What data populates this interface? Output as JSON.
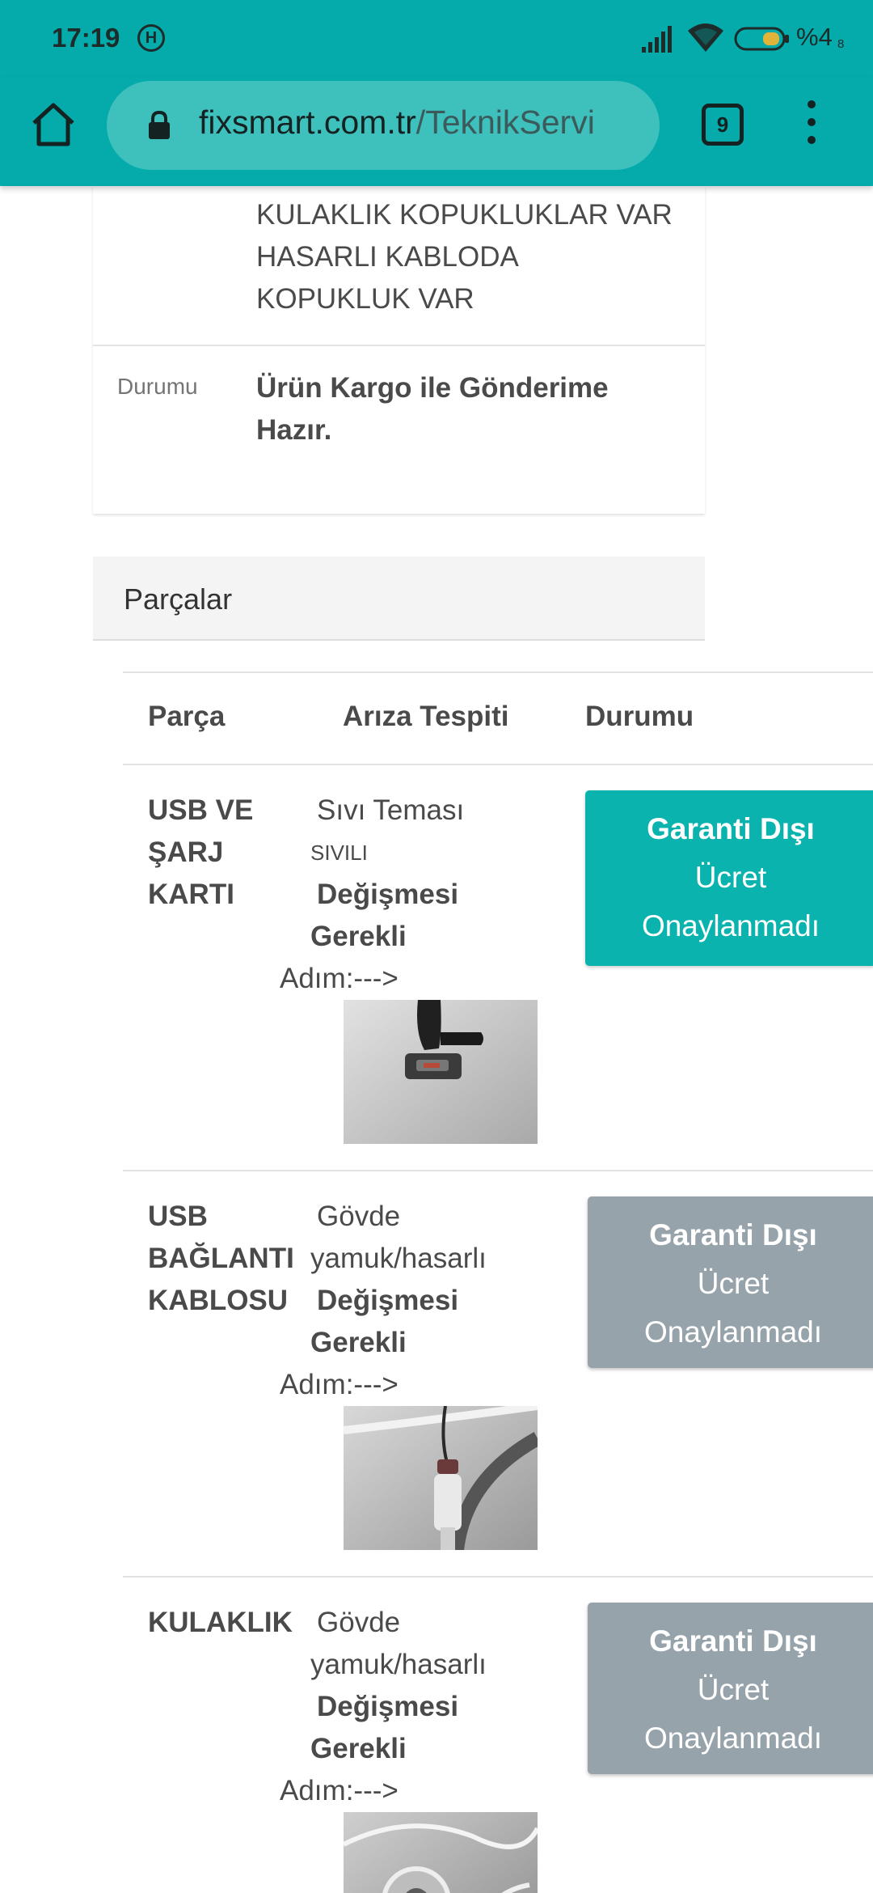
{
  "status_bar": {
    "time": "17:19",
    "h_badge": "H",
    "battery_percent": "%4",
    "battery_sub": "8"
  },
  "browser": {
    "url_domain": "fixsmart.com.tr",
    "url_path": "/TeknikServi",
    "tab_count": "9",
    "icons": [
      "home-icon",
      "lock-icon",
      "tabs-icon",
      "menu-icon"
    ]
  },
  "card": {
    "description_lines": [
      "KULAKLIK KOPUKLUKLAR VAR",
      "HASARLI KABLODA",
      "KOPUKLUK VAR"
    ],
    "status_label": "Durumu",
    "status_value": "Ürün Kargo ile Gönderime Hazır."
  },
  "parts": {
    "heading": "Parçalar",
    "columns": {
      "part": "Parça",
      "fault": "Arıza Tespiti",
      "status": "Durumu"
    },
    "rows": [
      {
        "name_lines": [
          "USB VE",
          "ŞARJ",
          "KARTI"
        ],
        "fault_line1": "Sıvı Teması",
        "fault_line2": "SIVILI",
        "action_line1": "Değişmesi",
        "action_line2": "Gerekli",
        "step": "Adım:--->",
        "status_lines": [
          "Garanti Dışı",
          "Ücret",
          "Onaylanmadı"
        ]
      },
      {
        "name_lines": [
          "USB",
          "BAĞLANTI",
          "KABLOSU"
        ],
        "fault_line1": "Gövde",
        "fault_line2": "yamuk/hasarlı",
        "action_line1": "Değişmesi",
        "action_line2": "Gerekli",
        "step": "Adım:--->",
        "status_lines": [
          "Garanti Dışı",
          "Ücret",
          "Onaylanmadı"
        ]
      },
      {
        "name_lines": [
          "KULAKLIK"
        ],
        "fault_line1": "Gövde",
        "fault_line2": "yamuk/hasarlı",
        "action_line1": "Değişmesi",
        "action_line2": "Gerekli",
        "step": "Adım:--->",
        "status_lines": [
          "Garanti Dışı",
          "Ücret",
          "Onaylanmadı"
        ]
      }
    ]
  },
  "colors": {
    "chrome_teal": "#04abaa",
    "active_status": "#0ab3ae",
    "inactive_status": "#97a3aa"
  }
}
